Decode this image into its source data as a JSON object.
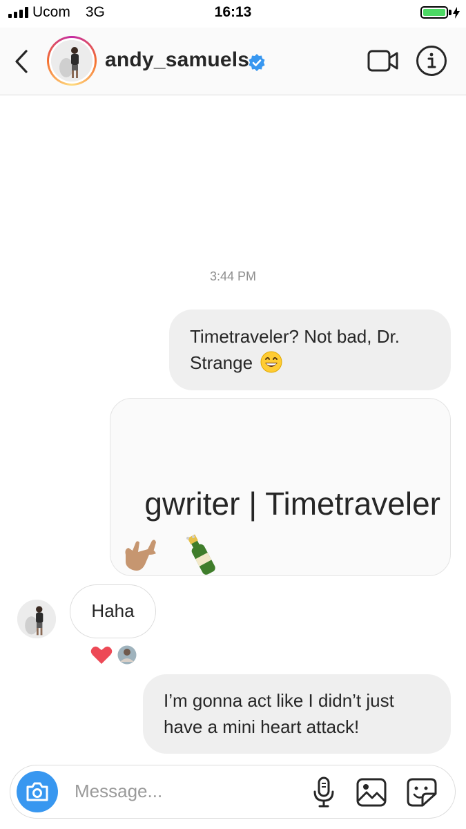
{
  "status_bar": {
    "carrier": "Ucom",
    "network": "3G",
    "time": "16:13",
    "battery_level": 1.0
  },
  "header": {
    "username": "andy_samuels",
    "verified": true,
    "icons": [
      "back-chevron-icon",
      "verified-badge-icon",
      "video-call-icon",
      "info-icon"
    ]
  },
  "chat": {
    "timestamp": "3:44 PM",
    "messages": [
      {
        "from": "me",
        "text": "Timetraveler? Not bad, Dr. Strange",
        "emoji": "grinning-face"
      },
      {
        "from": "me",
        "type": "shared-post",
        "text": "gwriter | Timetraveler",
        "emojis": [
          "call-me-hand",
          "champagne-bottle"
        ]
      },
      {
        "from": "andy_samuels",
        "text": "Haha",
        "reactions": [
          "heart"
        ]
      },
      {
        "from": "me",
        "text": "I’m gonna act like I didn’t just have a mini heart attack!"
      }
    ]
  },
  "composer": {
    "placeholder": "Message...",
    "icons": [
      "camera-icon",
      "microphone-icon",
      "gallery-icon",
      "sticker-icon"
    ]
  },
  "colors": {
    "accent_blue": "#3897f0",
    "bubble_gray": "#efefef",
    "heart_red": "#ed4956",
    "battery_green": "#4cd964"
  }
}
